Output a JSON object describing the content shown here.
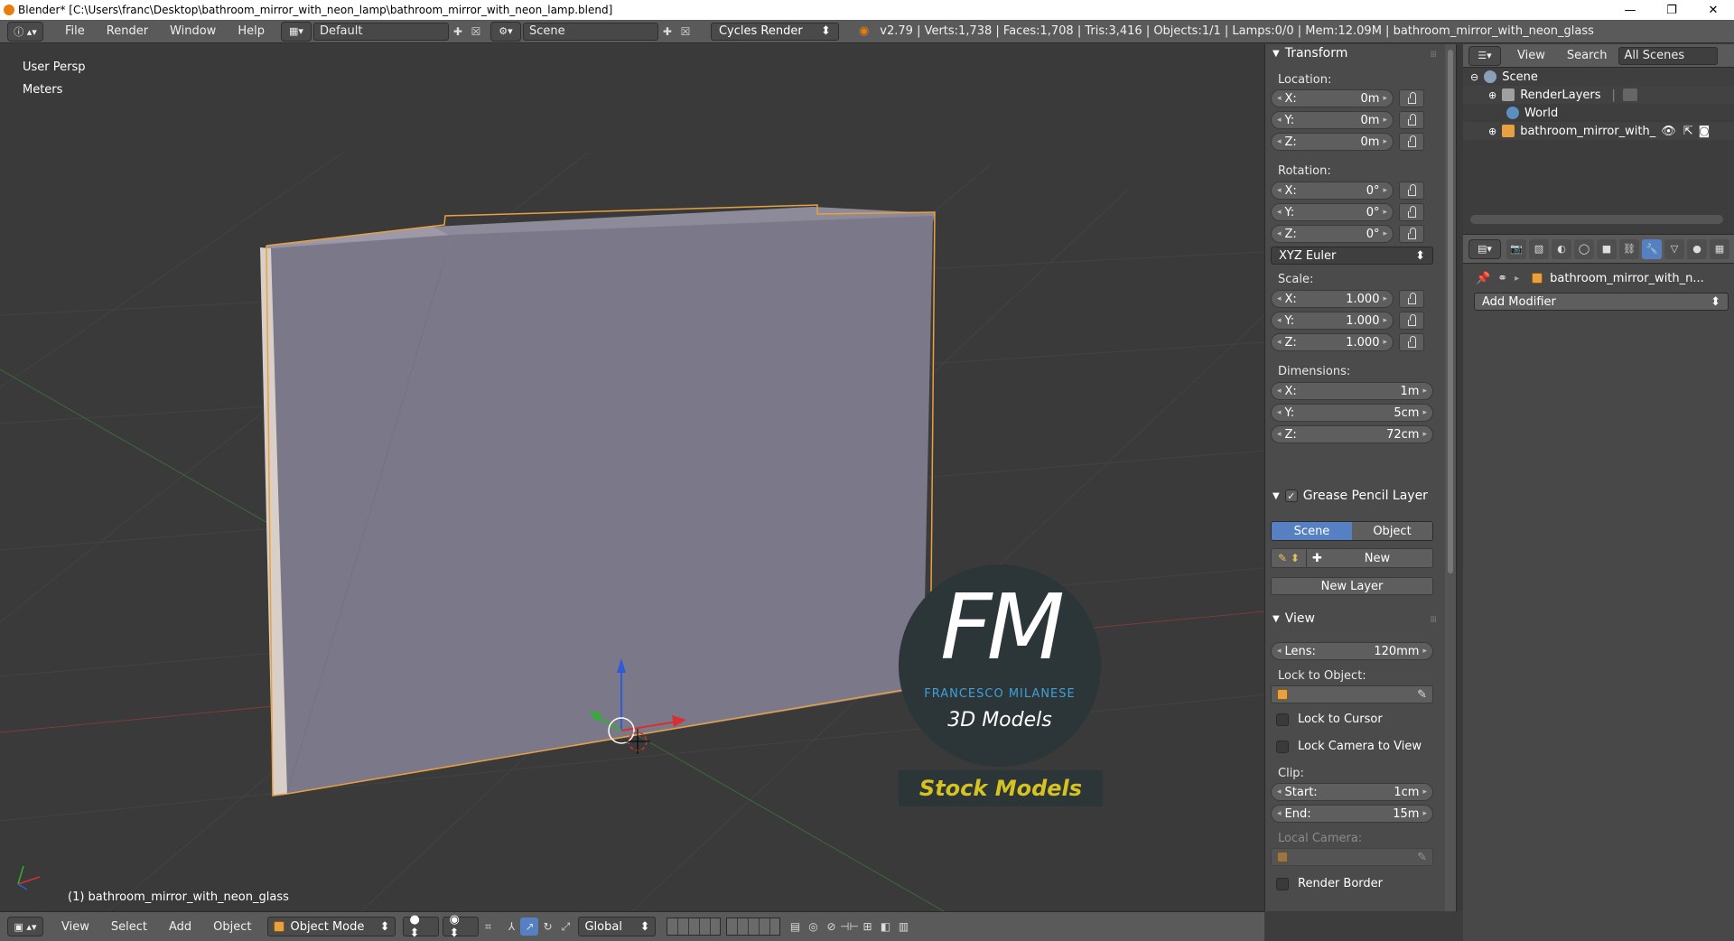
{
  "window": {
    "title": "Blender* [C:\\Users\\franc\\Desktop\\bathroom_mirror_with_neon_lamp\\bathroom_mirror_with_neon_lamp.blend]",
    "controls": {
      "minimize": "—",
      "maximize": "❐",
      "close": "✕"
    }
  },
  "info_header": {
    "menus": [
      "File",
      "Render",
      "Window",
      "Help"
    ],
    "layout": "Default",
    "scene": "Scene",
    "engine": "Cycles Render",
    "stats": "v2.79 | Verts:1,738 | Faces:1,708 | Tris:3,416 | Objects:1/1 | Lamps:0/0 | Mem:12.09M | bathroom_mirror_with_neon_glass"
  },
  "viewport": {
    "view_name": "User Persp",
    "units": "Meters",
    "active_object_label": "(1) bathroom_mirror_with_neon_glass"
  },
  "watermark": {
    "monogram": "FM",
    "brand": "FRANCESCO MILANESE",
    "tagline": "3D Models",
    "banner": "Stock Models"
  },
  "view3d_header": {
    "menus": [
      "View",
      "Select",
      "Add",
      "Object"
    ],
    "mode": "Object Mode",
    "orientation": "Global"
  },
  "transform": {
    "title": "Transform",
    "location_label": "Location:",
    "location": [
      {
        "axis": "X:",
        "value": "0m"
      },
      {
        "axis": "Y:",
        "value": "0m"
      },
      {
        "axis": "Z:",
        "value": "0m"
      }
    ],
    "rotation_label": "Rotation:",
    "rotation": [
      {
        "axis": "X:",
        "value": "0°"
      },
      {
        "axis": "Y:",
        "value": "0°"
      },
      {
        "axis": "Z:",
        "value": "0°"
      }
    ],
    "rotation_mode": "XYZ Euler",
    "scale_label": "Scale:",
    "scale": [
      {
        "axis": "X:",
        "value": "1.000"
      },
      {
        "axis": "Y:",
        "value": "1.000"
      },
      {
        "axis": "Z:",
        "value": "1.000"
      }
    ],
    "dimensions_label": "Dimensions:",
    "dimensions": [
      {
        "axis": "X:",
        "value": "1m"
      },
      {
        "axis": "Y:",
        "value": "5cm"
      },
      {
        "axis": "Z:",
        "value": "72cm"
      }
    ]
  },
  "grease_pencil": {
    "title": "Grease Pencil Layer",
    "scene_tab": "Scene",
    "object_tab": "Object",
    "new_label": "New",
    "new_layer_label": "New Layer"
  },
  "view_panel": {
    "title": "View",
    "lens_label": "Lens:",
    "lens_value": "120mm",
    "lock_to_object_label": "Lock to Object:",
    "lock_to_cursor": "Lock to Cursor",
    "lock_camera_to_view": "Lock Camera to View",
    "clip_label": "Clip:",
    "clip_start_label": "Start:",
    "clip_start": "1cm",
    "clip_end_label": "End:",
    "clip_end": "15m",
    "local_camera_label": "Local Camera:",
    "render_border": "Render Border"
  },
  "outliner": {
    "view_menu": "View",
    "search_menu": "Search",
    "filter": "All Scenes",
    "items": [
      {
        "label": "Scene"
      },
      {
        "label": "RenderLayers"
      },
      {
        "label": "World"
      },
      {
        "label": "bathroom_mirror_with_"
      }
    ]
  },
  "properties": {
    "object_name": "bathroom_mirror_with_n...",
    "add_modifier": "Add Modifier"
  },
  "colors": {
    "accent_blue": "#5680c2",
    "selection_orange": "#e8a040",
    "mesh_fill": "#7a7889",
    "watermark_yellow": "#d6c220"
  }
}
